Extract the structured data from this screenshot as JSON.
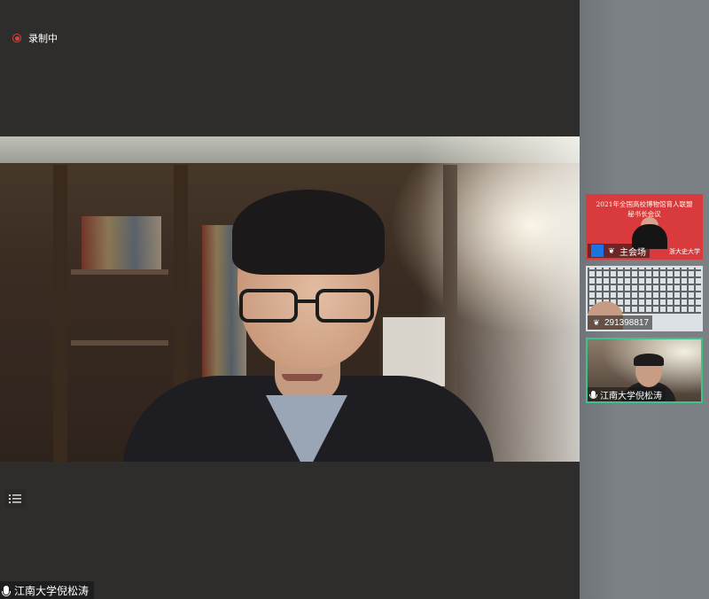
{
  "recording": {
    "label": "录制中",
    "color": "#e23b36"
  },
  "main_video": {
    "speaker_name": "江南大学倪松涛"
  },
  "sidebar_toggle": {
    "icon": "list-icon",
    "glyph": "⁝☰"
  },
  "participants": [
    {
      "name": "主会场",
      "badge": "host-icon",
      "slide_title_line1": "2021年全国高校博物馆育人联盟",
      "slide_title_line2": "秘书长会议",
      "slide_sign": "浙大史大学"
    },
    {
      "name": "291398817",
      "badge": "logo-icon"
    },
    {
      "name": "江南大学倪松涛",
      "badge": "mic-icon",
      "active": true
    }
  ],
  "colors": {
    "active_tile_border": "#3ec28a",
    "host_badge": "#1a73e8"
  }
}
